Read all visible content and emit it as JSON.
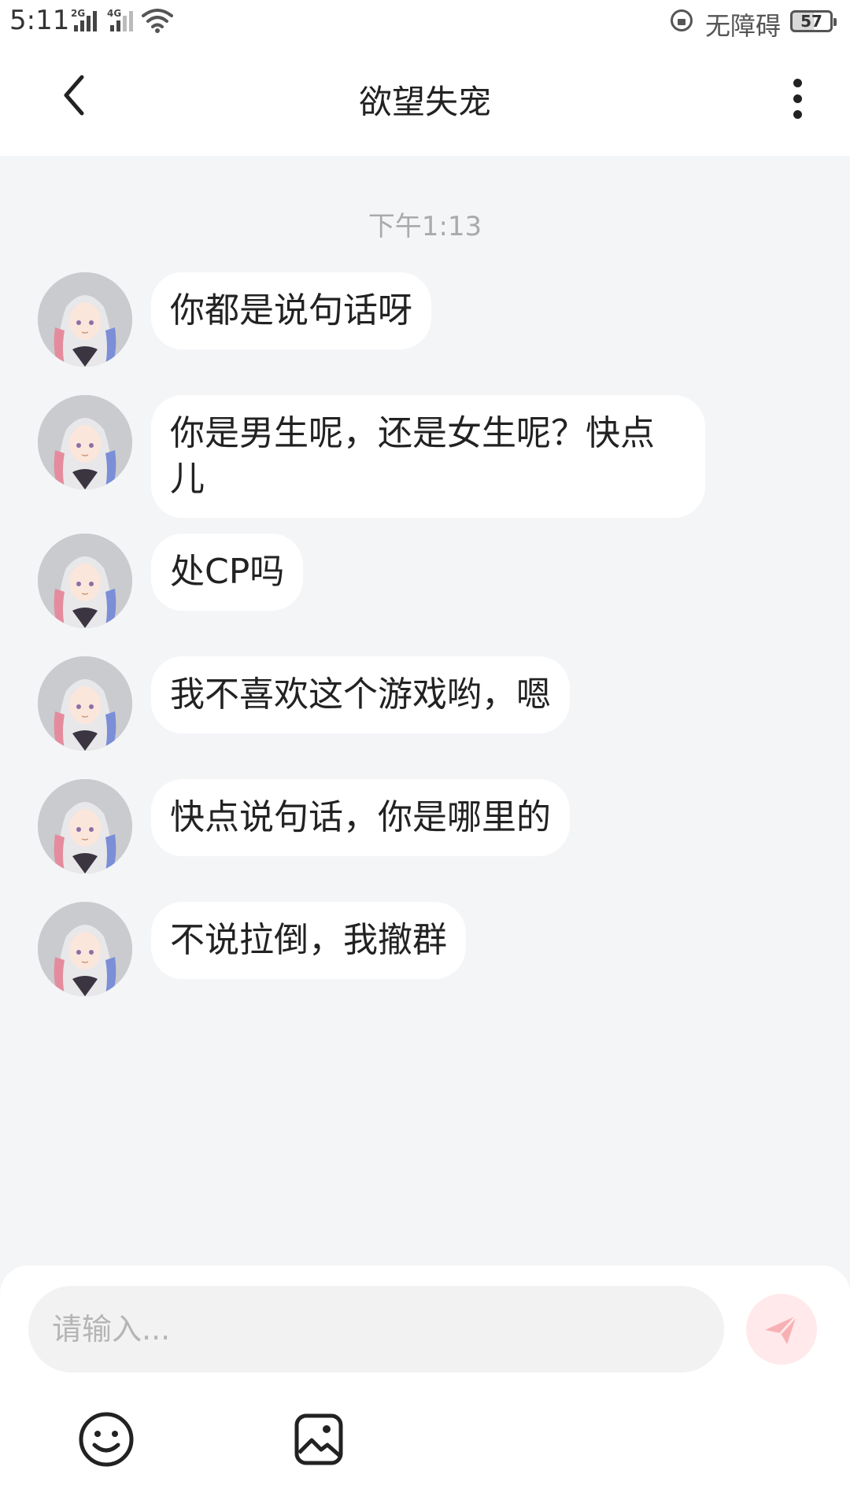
{
  "status_bar": {
    "time": "5:11",
    "signal_1_label": "2G",
    "signal_2_label": "4G",
    "accessibility_label": "无障碍",
    "battery_level": "57"
  },
  "header": {
    "title": "欲望失宠",
    "icons": {
      "back": "back-chevron-icon",
      "more": "more-vertical-icon"
    }
  },
  "chat": {
    "timestamp": "下午1:13",
    "messages": [
      {
        "text": "你都是说句话呀"
      },
      {
        "text": "你是男生呢，还是女生呢？快点儿"
      },
      {
        "text": "处CP吗"
      },
      {
        "text": "我不喜欢这个游戏哟，嗯"
      },
      {
        "text": "快点说句话，你是哪里的"
      },
      {
        "text": "不说拉倒，我撤群"
      }
    ]
  },
  "input": {
    "placeholder": "请输入...",
    "value": "",
    "icons": {
      "send": "send-paper-plane-icon",
      "emoji": "smiley-face-icon",
      "image": "image-picture-icon"
    }
  },
  "colors": {
    "chat_background": "#f4f5f7",
    "bubble": "#ffffff",
    "send_button": "#ffe9ea",
    "send_icon": "#f7b1b4"
  }
}
